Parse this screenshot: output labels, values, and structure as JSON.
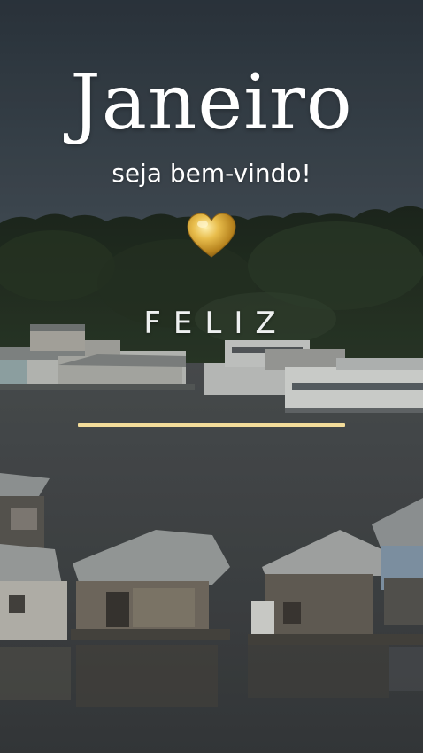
{
  "story": {
    "title": "Janeiro",
    "subtitle": "seja bem-vindo!",
    "word": "FELIZ",
    "heart_icon": "gold-heart-icon",
    "colors": {
      "text": "#ffffff",
      "divider": "#f3dc9a",
      "heart": "#d9a72c",
      "sky": "#3b4650",
      "water": "#4a4f52"
    }
  }
}
